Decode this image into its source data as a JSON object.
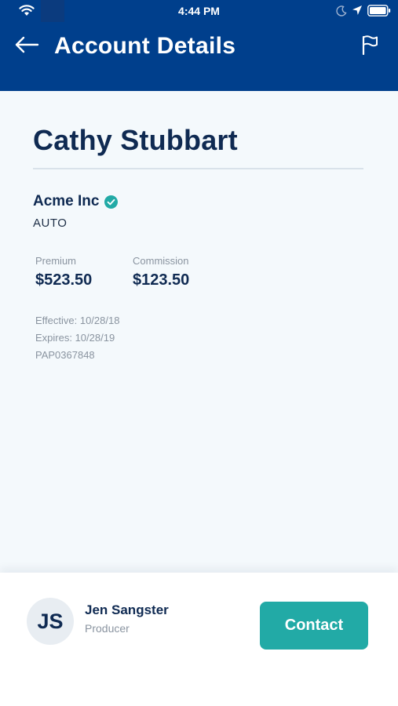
{
  "status_bar": {
    "time": "4:44 PM",
    "icons": [
      "wifi-icon",
      "moon-icon",
      "location-icon",
      "battery-icon"
    ]
  },
  "header": {
    "title": "Account Details",
    "back_icon": "arrow-left-icon",
    "flag_icon": "flag-icon"
  },
  "account": {
    "name": "Cathy Stubbart",
    "company": "Acme Inc",
    "verified": true,
    "policy_type": "AUTO",
    "premium_label": "Premium",
    "premium_value": "$523.50",
    "commission_label": "Commission",
    "commission_value": "$123.50",
    "effective": "Effective: 10/28/18",
    "expires": "Expires: 10/28/19",
    "policy_number": "PAP0367848"
  },
  "producer": {
    "initials": "JS",
    "name": "Jen Sangster",
    "role": "Producer",
    "contact_label": "Contact"
  },
  "colors": {
    "header_bg": "#003f8c",
    "content_bg": "#f4f9fc",
    "primary_text": "#0f2a52",
    "muted_text": "#8a94a0",
    "accent_teal": "#22aaa6"
  }
}
